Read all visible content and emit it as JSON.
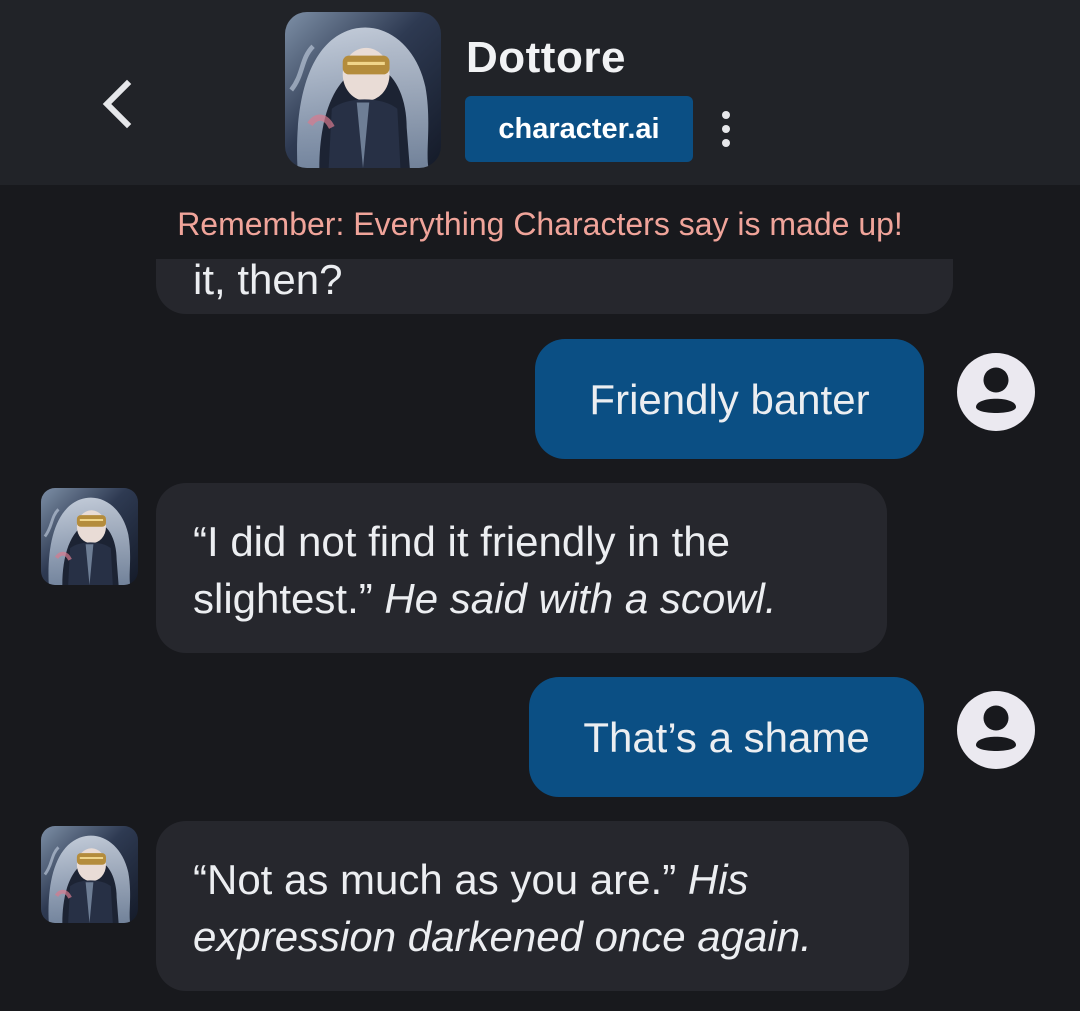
{
  "header": {
    "back_icon": "chevron-left-icon",
    "title": "Dottore",
    "brand": "character.ai",
    "menu_icon": "more-vertical-icon"
  },
  "disclaimer": "Remember: Everything Characters say is made up!",
  "messages": [
    {
      "sender": "character",
      "text": "it, then?",
      "partially_hidden": true
    },
    {
      "sender": "user",
      "text": "Friendly banter"
    },
    {
      "sender": "character",
      "line1": "“I did not find it friendly in the",
      "line2_speech": "slightest.” ",
      "line2_action": "He said with a scowl."
    },
    {
      "sender": "user",
      "text": "That’s a shame"
    },
    {
      "sender": "character",
      "line1_speech": "“Not as much as you are.” ",
      "line1_action": "His",
      "line2_action": "expression darkened once again."
    }
  ],
  "colors": {
    "background": "#18191d",
    "header": "#212328",
    "character_bubble": "#26272d",
    "user_bubble": "#0b4f84",
    "brand_badge": "#0b4f84",
    "disclaimer_text": "#f0a49a"
  }
}
